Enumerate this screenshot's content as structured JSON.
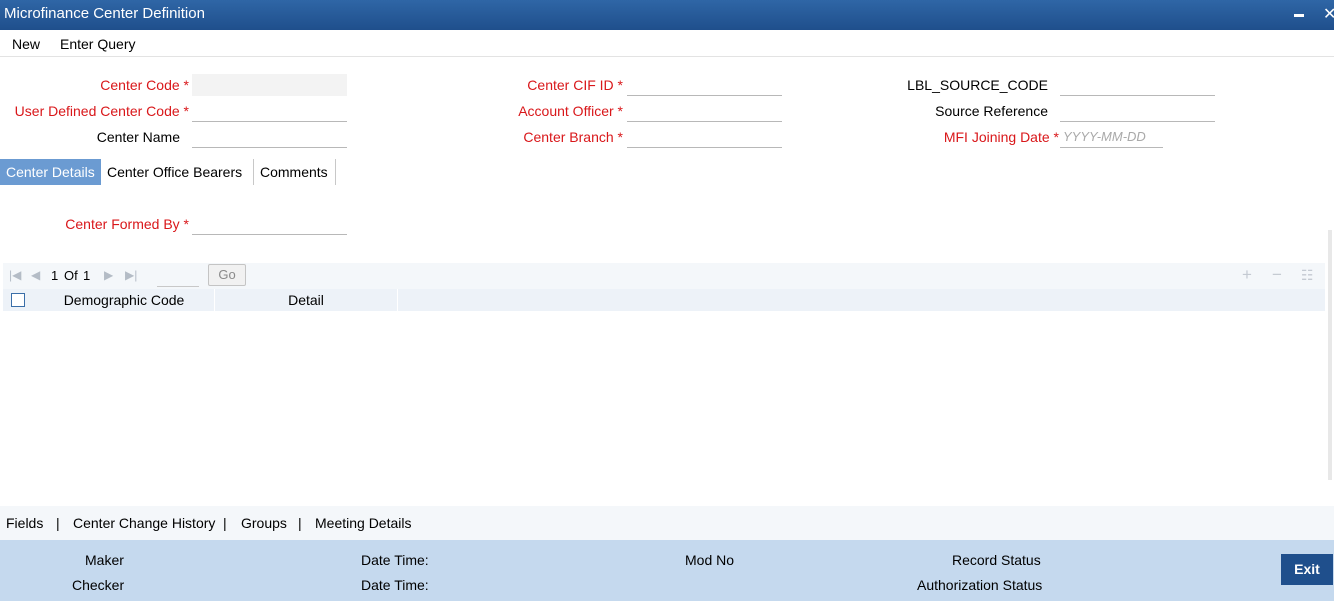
{
  "window": {
    "title": "Microfinance Center Definition",
    "minimize_glyph": "▬",
    "close_glyph": "✕"
  },
  "menu": {
    "new_label": "New",
    "enter_query_label": "Enter Query"
  },
  "header_fields": {
    "center_code": {
      "label": "Center Code",
      "value": ""
    },
    "user_defined_center_code": {
      "label": "User Defined Center Code",
      "value": ""
    },
    "center_name": {
      "label": "Center Name",
      "value": ""
    },
    "center_cif_id": {
      "label": "Center CIF ID",
      "value": ""
    },
    "account_officer": {
      "label": "Account Officer",
      "value": ""
    },
    "center_branch": {
      "label": "Center Branch",
      "value": ""
    },
    "source_code": {
      "label": "LBL_SOURCE_CODE",
      "value": ""
    },
    "source_reference": {
      "label": "Source Reference",
      "value": ""
    },
    "mfi_joining_date": {
      "label": "MFI Joining Date",
      "value": "",
      "placeholder": "YYYY-MM-DD"
    },
    "required_marker": "*"
  },
  "tabs": [
    {
      "label": "Center Details",
      "active": true
    },
    {
      "label": "Center Office Bearers",
      "active": false
    },
    {
      "label": "Comments",
      "active": false
    }
  ],
  "center_details": {
    "center_formed_by": {
      "label": "Center Formed By",
      "value": ""
    }
  },
  "grid": {
    "page_current": "1",
    "page_of": "Of",
    "page_total": "1",
    "go_label": "Go",
    "columns": [
      "Demographic Code",
      "Detail"
    ],
    "rows": []
  },
  "footer_links": [
    "Fields",
    "Center Change History",
    "Groups",
    "Meeting Details"
  ],
  "footer_separator": "|",
  "audit": {
    "maker": "Maker",
    "checker": "Checker",
    "date_time_1": "Date Time:",
    "date_time_2": "Date Time:",
    "mod_no": "Mod No",
    "record_status": "Record Status",
    "authorization_status": "Authorization Status",
    "exit_label": "Exit"
  },
  "colors": {
    "titlebar": "#1f4f8c",
    "required_label": "#d9171a",
    "active_tab": "#6b9bd2",
    "audit_bar": "#c5d9ee"
  }
}
